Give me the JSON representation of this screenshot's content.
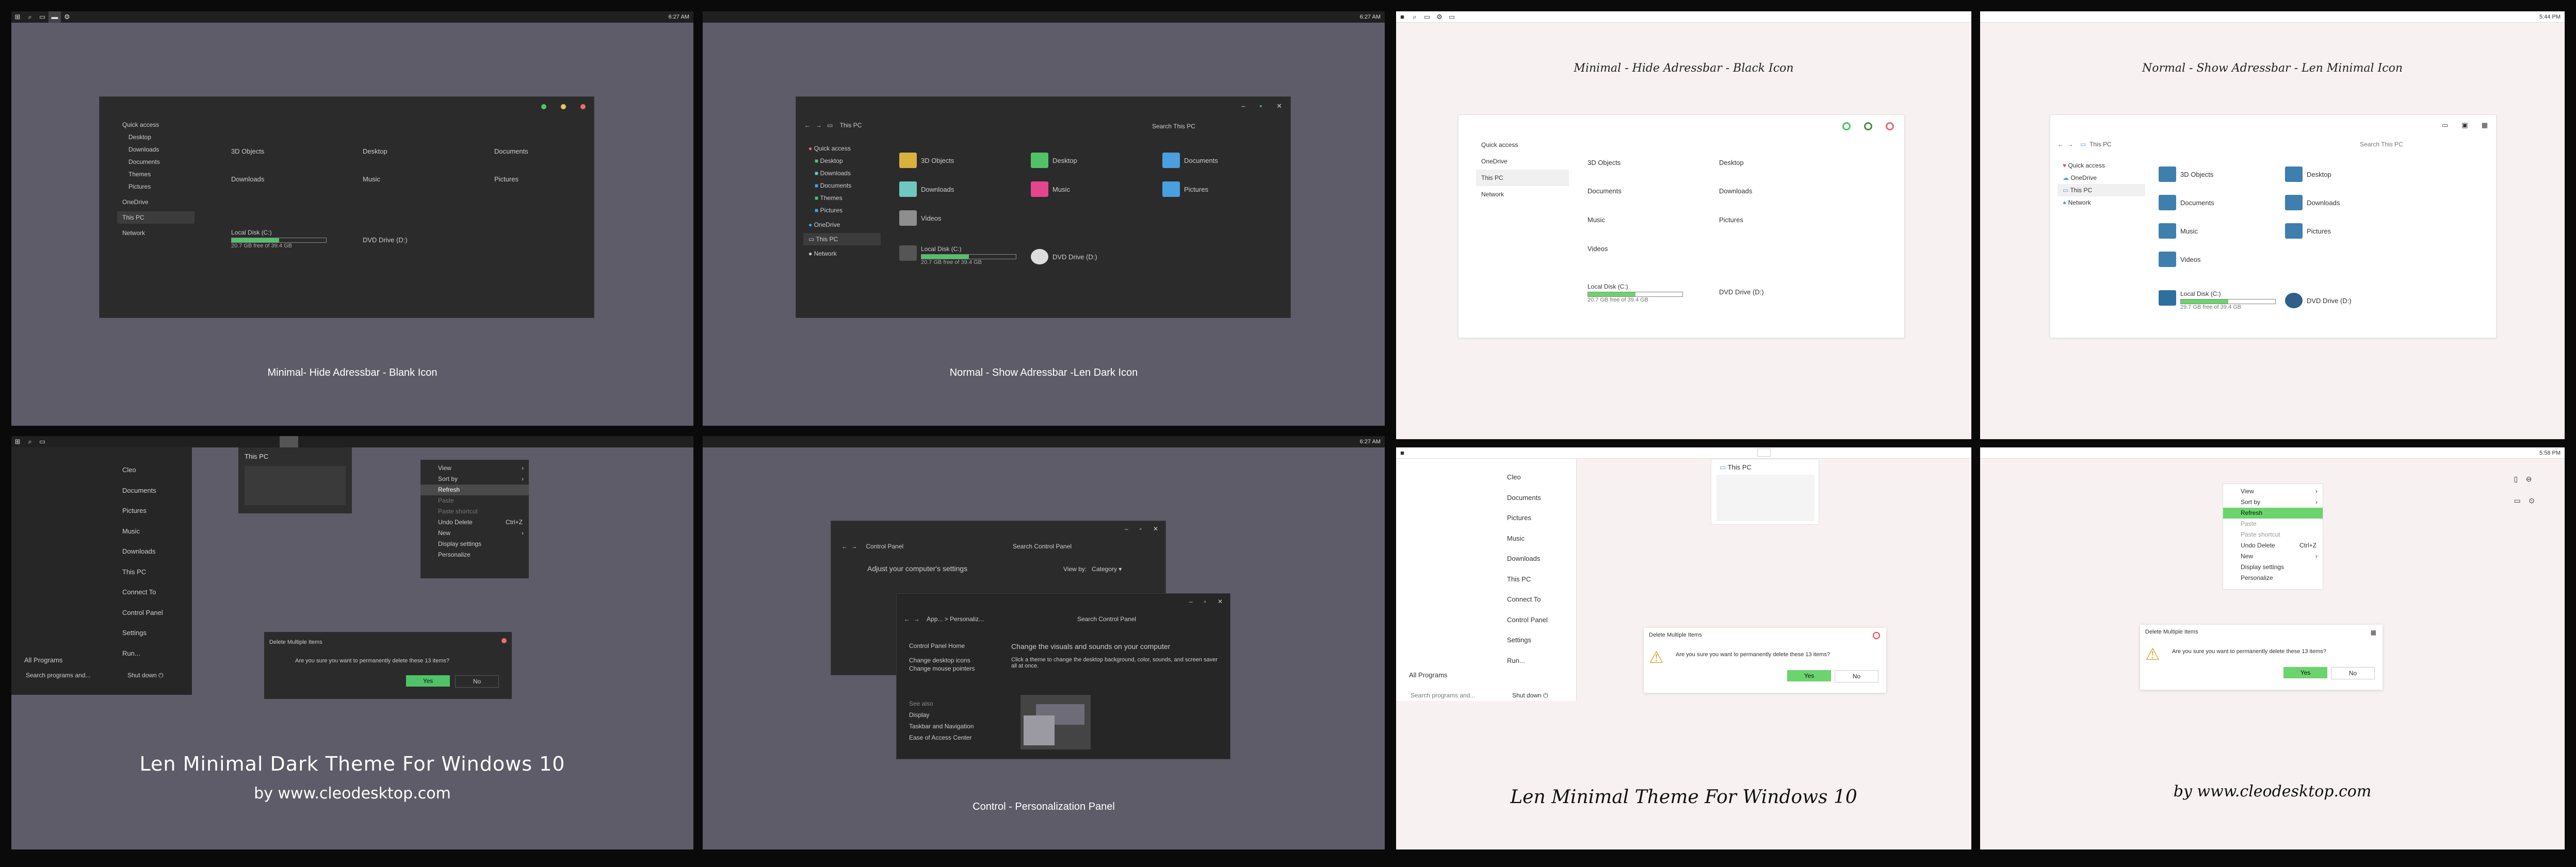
{
  "colors": {
    "dark_bg": "#5d5c68",
    "light_bg": "#f7f2f1",
    "accent_green": "#6bd46d",
    "dot_green": "#51c26a",
    "dot_yellow": "#e8c65a",
    "dot_red": "#e86c6c"
  },
  "common": {
    "quick_access": "Quick access",
    "desktop": "Desktop",
    "downloads": "Downloads",
    "documents": "Documents",
    "themes": "Themes",
    "pictures": "Pictures",
    "onedrive": "OneDrive",
    "this_pc": "This PC",
    "network": "Network",
    "objects3d": "3D Objects",
    "music": "Music",
    "videos": "Videos",
    "local_disk": "Local Disk (C:)",
    "disk_free": "20.7 GB free of 39.4 GB",
    "disk_free_2": "29.7 GB free of 39.4 GB",
    "dvd": "DVD Drive (D:)",
    "search_pc": "Search This PC"
  },
  "panels": {
    "p1": {
      "caption": "Minimal- Hide Adressbar - Blank Icon",
      "time": "6:27 AM"
    },
    "p2": {
      "caption": "Normal - Show Adressbar -Len Dark Icon",
      "time": "6:27 AM",
      "address": "This PC"
    },
    "p3": {
      "caption": "Minimal - Hide Adressbar - Black Icon"
    },
    "p4": {
      "caption": "Normal - Show Adressbar - Len Minimal Icon",
      "time": "5:44 PM",
      "address": "This PC"
    },
    "p5": {
      "title_main": "Len Minimal Dark Theme For Windows 10",
      "title_sub": "by www.cleodesktop.com",
      "thumb": "This PC"
    },
    "p6": {
      "caption": "Control - Personalization Panel",
      "time": "6:27 AM"
    },
    "p7": {
      "title": "Len Minimal Theme For Windows 10",
      "thumb": "This PC"
    },
    "p8": {
      "title": "by www.cleodesktop.com",
      "time": "5:58 PM"
    }
  },
  "start_menu": {
    "items": [
      "Cleo",
      "Documents",
      "Pictures",
      "Music",
      "Downloads",
      "This PC",
      "Connect To",
      "Control Panel",
      "Settings",
      "Run..."
    ],
    "all_programs": "All Programs",
    "search": "Search programs and...",
    "shutdown": "Shut down",
    "search_light": "Search programs and..."
  },
  "context_menu": {
    "items": [
      "View",
      "Sort by",
      "Refresh",
      "Paste",
      "Paste shortcut",
      "Undo Delete",
      "New",
      "Display settings",
      "Personalize"
    ],
    "shortcut": "Ctrl+Z"
  },
  "dialog": {
    "title": "Delete Multiple Items",
    "message": "Are you sure you want to permanently delete these 13 items?",
    "yes": "Yes",
    "no": "No"
  },
  "control_panel": {
    "address": "Control Panel",
    "search": "Search Control Panel",
    "heading": "Adjust your computer's settings",
    "view_by": "View by:",
    "category": "Category",
    "p_address": "App... > Personaliz...",
    "p_home": "Control Panel Home",
    "p_link1": "Change desktop icons",
    "p_link2": "Change mouse pointers",
    "p_heading": "Change the visuals and sounds on your computer",
    "p_desc": "Click a theme to change the desktop background, color, sounds, and screen saver all at once.",
    "see_also": "See also",
    "sa1": "Display",
    "sa2": "Taskbar and Navigation",
    "sa3": "Ease of Access Center"
  }
}
